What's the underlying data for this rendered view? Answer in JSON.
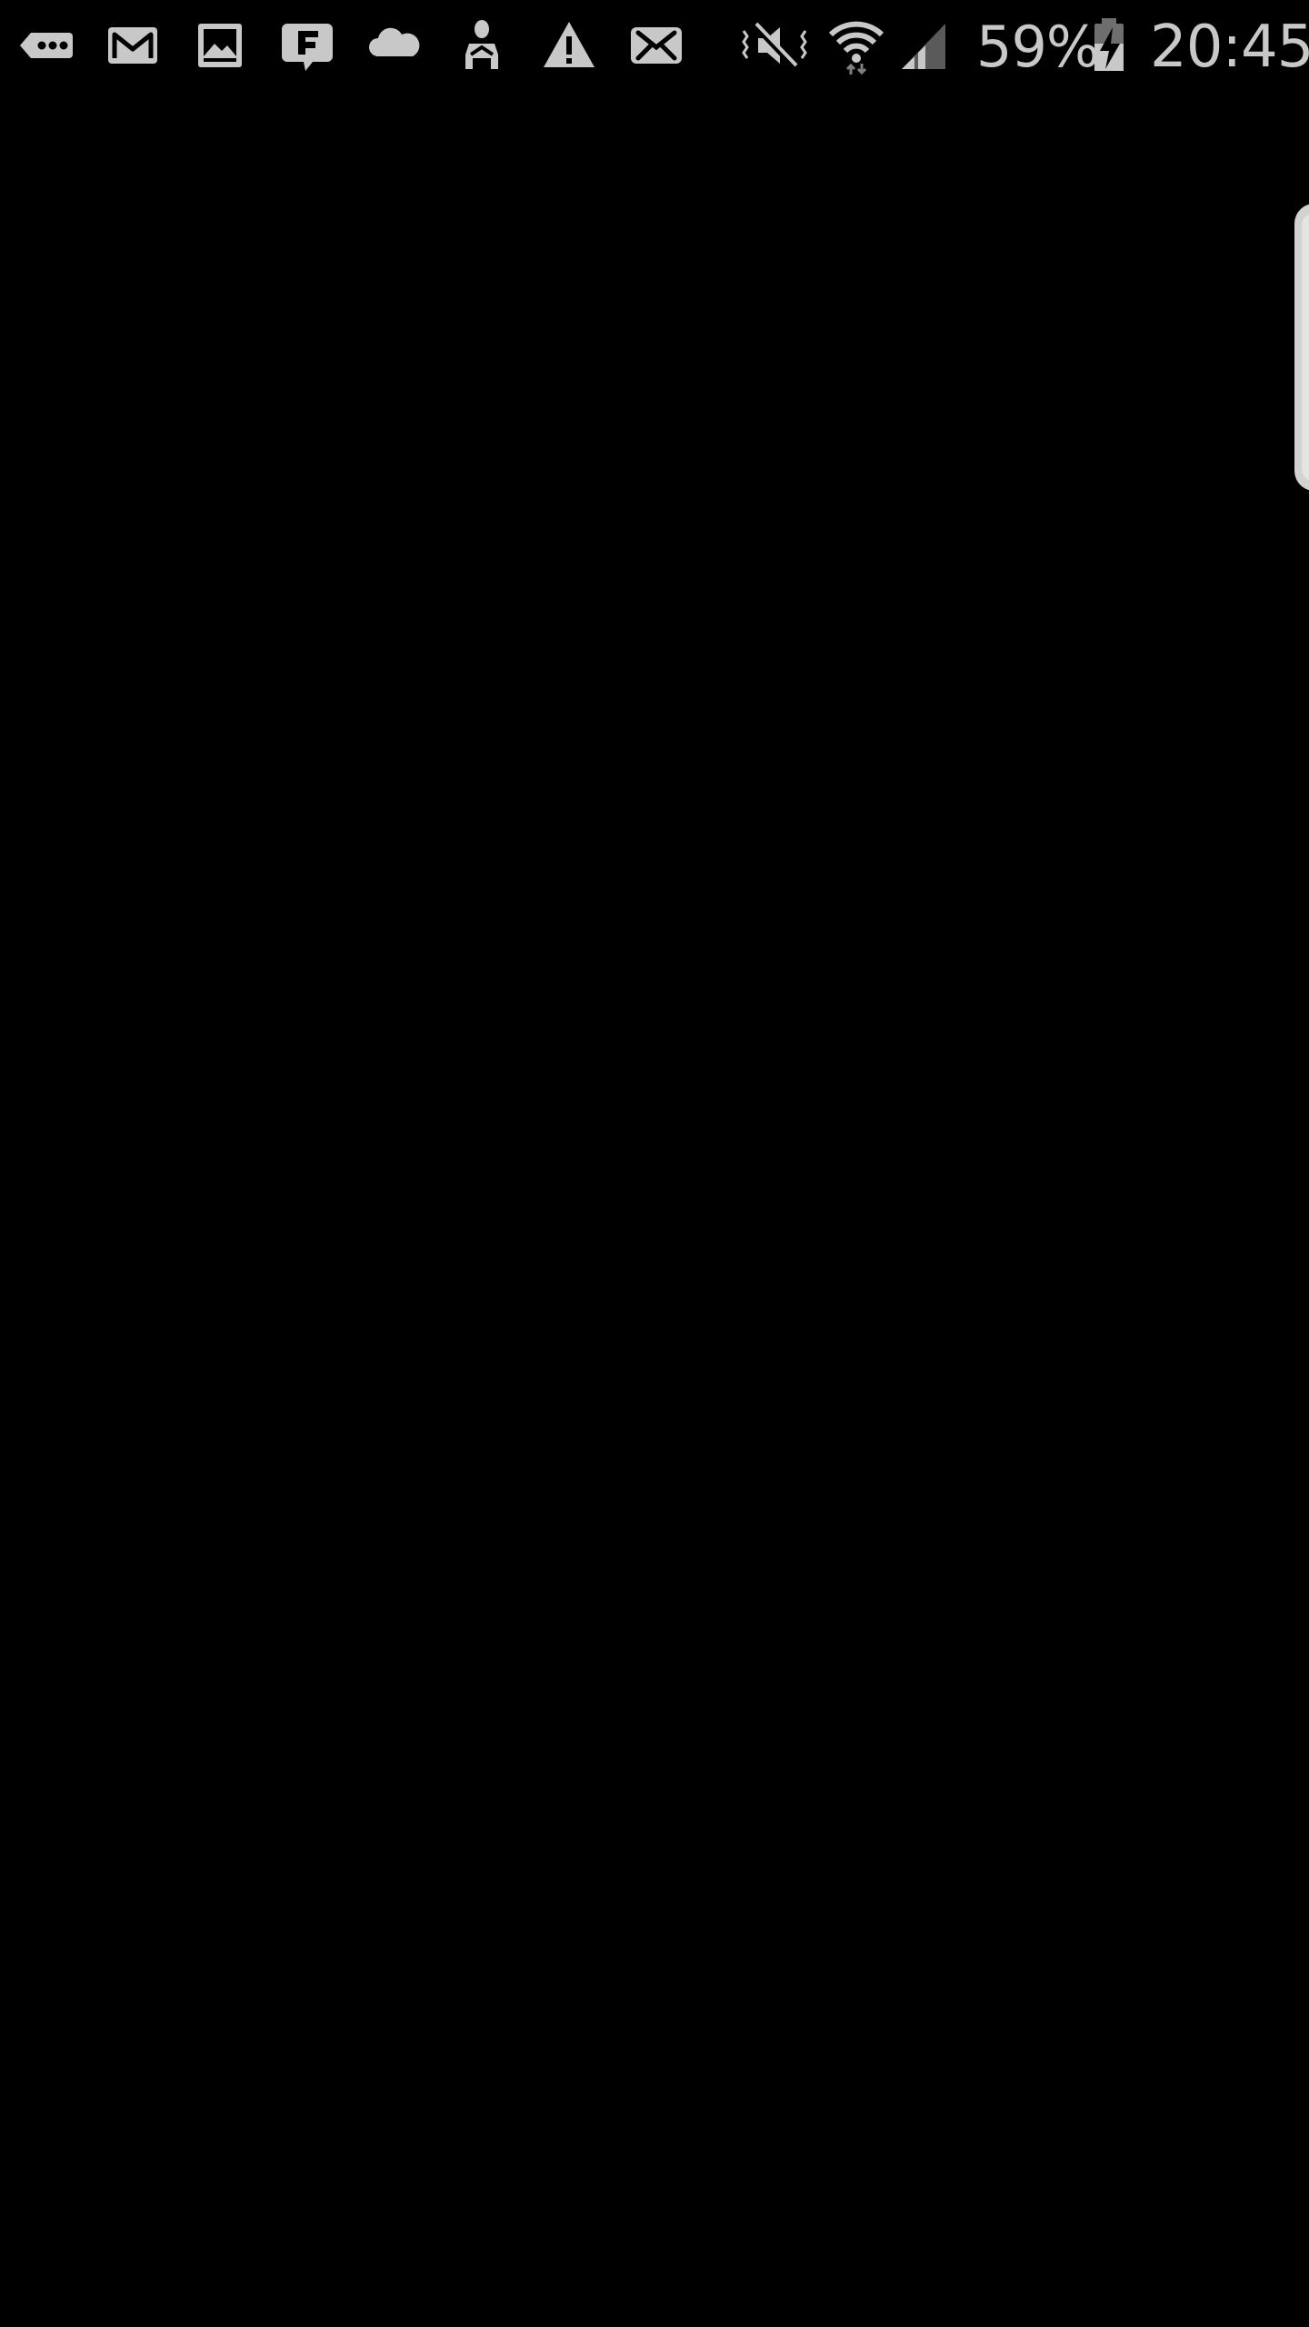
{
  "status_bar": {
    "notification_icons": [
      "sms-icon",
      "gmail-icon",
      "gallery-icon",
      "foursquare-icon",
      "cloud-icon",
      "person-icon",
      "warning-icon",
      "email-icon"
    ],
    "system_icons": [
      "vibrate-mute-icon",
      "wifi-icon",
      "signal-icon",
      "battery-charging-icon"
    ],
    "battery_percent": "59%",
    "time": "20:45",
    "icon_color": "#c8c8c8"
  },
  "screen": {
    "background": "#000000"
  }
}
